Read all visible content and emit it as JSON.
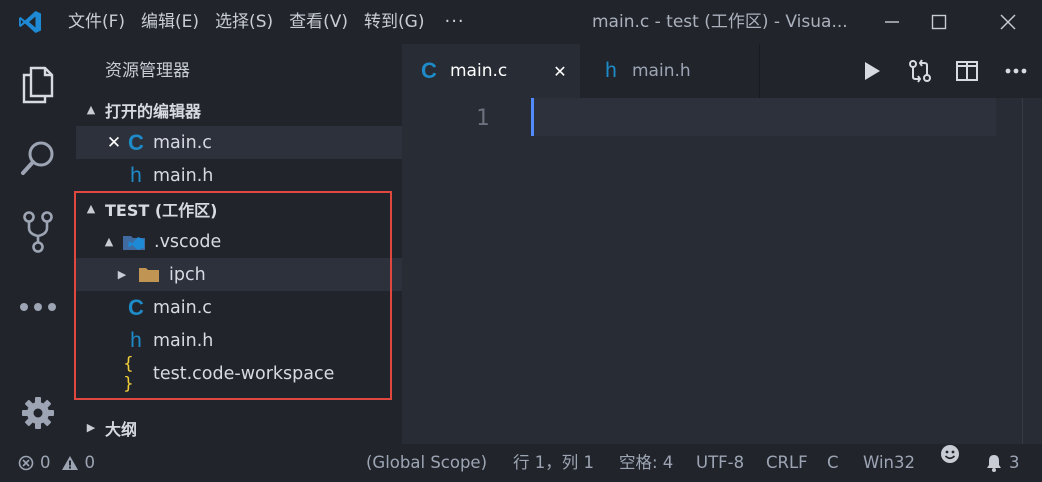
{
  "titlebar": {
    "menu": [
      "文件(F)",
      "编辑(E)",
      "选择(S)",
      "查看(V)",
      "转到(G)"
    ],
    "more": "···",
    "window_title": "main.c - test (工作区) - Visua..."
  },
  "sidebar": {
    "title": "资源管理器",
    "open_editors": {
      "label": "打开的编辑器",
      "items": [
        {
          "name": "main.c",
          "icon": "C"
        },
        {
          "name": "main.h",
          "icon": "h"
        }
      ]
    },
    "workspace": {
      "label": "TEST (工作区)",
      "items": [
        {
          "name": ".vscode",
          "type": "folder-expanded"
        },
        {
          "name": "ipch",
          "type": "folder-collapsed"
        },
        {
          "name": "main.c",
          "icon": "C"
        },
        {
          "name": "main.h",
          "icon": "h"
        },
        {
          "name": "test.code-workspace",
          "icon": "{ }"
        }
      ]
    },
    "outline": {
      "label": "大纲"
    }
  },
  "tabs": [
    {
      "label": "main.c",
      "icon": "C",
      "active": true,
      "close": "✕"
    },
    {
      "label": "main.h",
      "icon": "h",
      "active": false
    }
  ],
  "editor": {
    "line_number": "1"
  },
  "statusbar": {
    "errors": "0",
    "warnings": "0",
    "scope": "(Global Scope)",
    "position": "行 1，列 1",
    "spaces": "空格: 4",
    "encoding": "UTF-8",
    "eol": "CRLF",
    "language": "C",
    "platform": "Win32",
    "notifications": "3"
  },
  "colors": {
    "accent": "#1e8ac8",
    "highlight_box": "#e0473e",
    "cursor": "#528bff"
  }
}
